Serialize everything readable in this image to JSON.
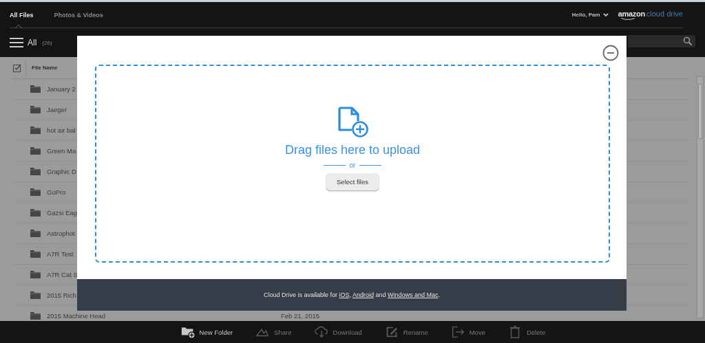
{
  "tabs": [
    {
      "label": "All Files",
      "selected": true
    },
    {
      "label": "Photos & Videos",
      "selected": false
    }
  ],
  "user_menu": {
    "label": "Hello, Pam"
  },
  "logo": {
    "brand": "amazon",
    "product": "cloud drive"
  },
  "filter": {
    "label": "All",
    "count": "(26)"
  },
  "table": {
    "columns": [
      "File Name"
    ],
    "rows": [
      {
        "name": "January 2"
      },
      {
        "name": "Jaeger"
      },
      {
        "name": "hot air bal"
      },
      {
        "name": "Green Ma"
      },
      {
        "name": "Graphic D"
      },
      {
        "name": "GoPro"
      },
      {
        "name": "Gazsi Eag"
      },
      {
        "name": "Astrophot"
      },
      {
        "name": "A7R Test"
      },
      {
        "name": "A7R Cat S"
      },
      {
        "name": "2015 Rich"
      },
      {
        "name": "2015 Machine Head",
        "date": "Feb 21, 2015"
      }
    ]
  },
  "toolbar": [
    {
      "kind": "new-folder",
      "label": "New Folder",
      "disabled": false
    },
    {
      "kind": "share",
      "label": "Share",
      "disabled": true
    },
    {
      "kind": "download",
      "label": "Download",
      "disabled": true
    },
    {
      "kind": "rename",
      "label": "Rename",
      "disabled": true
    },
    {
      "kind": "move",
      "label": "Move",
      "disabled": true
    },
    {
      "kind": "delete",
      "label": "Delete",
      "disabled": true
    }
  ],
  "upload_dialog": {
    "heading": "Drag files here to upload",
    "separator": "or",
    "button": "Select files",
    "footer": {
      "text": "Cloud Drive is available for ",
      "links": [
        "iOS",
        "Android",
        "Windows and Mac"
      ],
      "joiners": [
        ", ",
        " and ",
        "."
      ]
    }
  }
}
